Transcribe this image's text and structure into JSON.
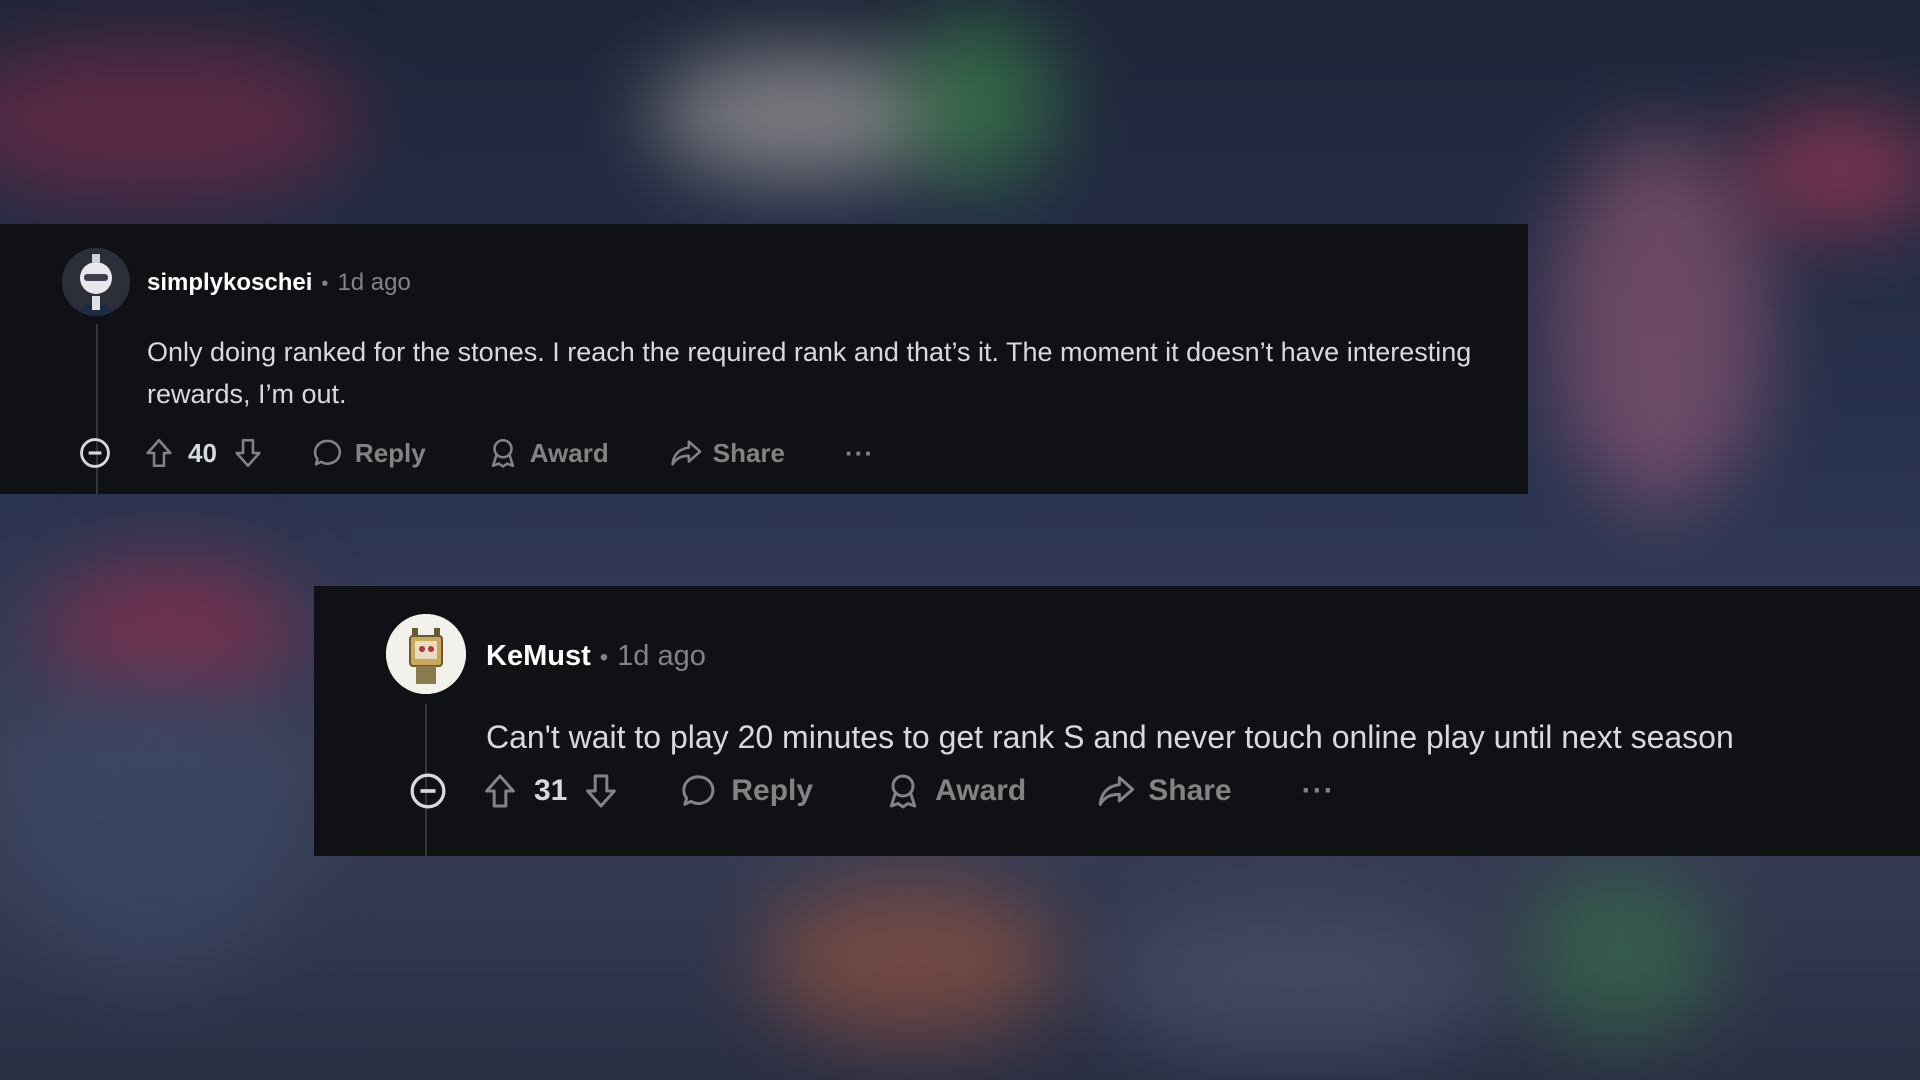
{
  "comments": [
    {
      "username": "simplykoschei",
      "separator": "•",
      "time": "1d ago",
      "body": "Only doing ranked for the stones. I reach the required rank and that’s it. The moment it doesn’t have interesting rewards, I’m out.",
      "score": "40",
      "reply_label": "Reply",
      "award_label": "Award",
      "share_label": "Share",
      "more_label": "···"
    },
    {
      "username": "KeMust",
      "separator": "•",
      "time": "1d ago",
      "body": "Can't wait to play 20 minutes to get rank S and never touch online play until next season",
      "score": "31",
      "reply_label": "Reply",
      "award_label": "Award",
      "share_label": "Share",
      "more_label": "···"
    }
  ],
  "icons": {
    "collapse": "minus-circle-icon",
    "upvote": "arrow-up-icon",
    "downvote": "arrow-down-icon",
    "reply": "speech-bubble-icon",
    "award": "award-ribbon-icon",
    "share": "share-arrow-icon"
  },
  "colors": {
    "card_background": "#0f1114",
    "username": "#ffffff",
    "meta": "#818384",
    "body_text": "#d7dadc"
  }
}
